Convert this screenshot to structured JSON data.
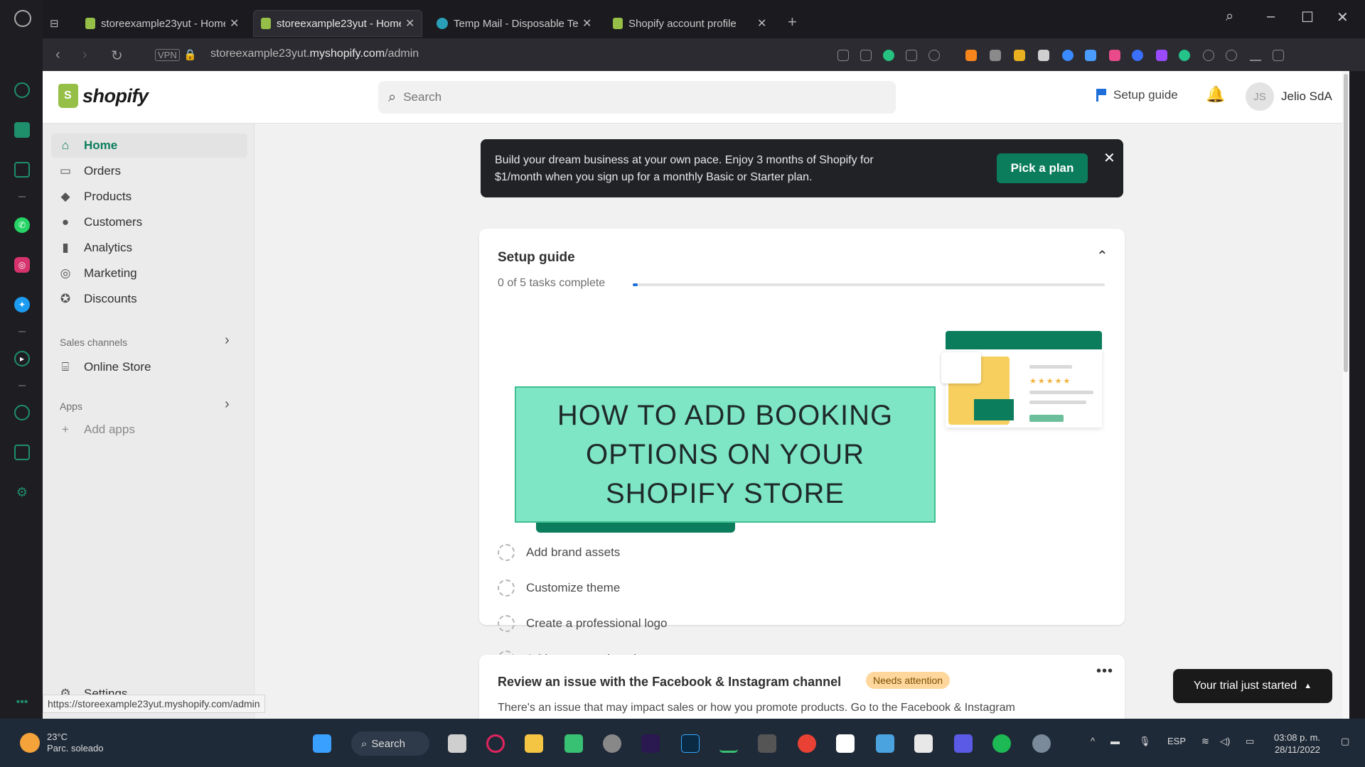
{
  "browser": {
    "tabs": [
      {
        "label": "storeexample23yut - Home",
        "active": false
      },
      {
        "label": "storeexample23yut - Home",
        "active": true
      },
      {
        "label": "Temp Mail - Disposable Te",
        "active": false
      },
      {
        "label": "Shopify account profile",
        "active": false
      }
    ],
    "url_prefix": "storeexample23yut.",
    "url_host": "myshopify.com",
    "url_path": "/admin",
    "status_url": "https://storeexample23yut.myshopify.com/admin"
  },
  "topbar": {
    "logo": "shopify",
    "search_placeholder": "Search",
    "setup_guide": "Setup guide",
    "user_initials": "JS",
    "user_name": "Jelio SdA"
  },
  "nav": {
    "items": [
      {
        "label": "Home",
        "icon": "home-icon"
      },
      {
        "label": "Orders",
        "icon": "orders-icon"
      },
      {
        "label": "Products",
        "icon": "tag-icon"
      },
      {
        "label": "Customers",
        "icon": "person-icon"
      },
      {
        "label": "Analytics",
        "icon": "bar-chart-icon"
      },
      {
        "label": "Marketing",
        "icon": "target-icon"
      },
      {
        "label": "Discounts",
        "icon": "discount-icon"
      }
    ],
    "sales_channels": "Sales channels",
    "online_store": "Online Store",
    "apps": "Apps",
    "add_apps": "Add apps",
    "settings": "Settings"
  },
  "banner": {
    "text": "Build your dream business at your own pace. Enjoy 3 months of Shopify for $1/month when you sign up for a monthly Basic or Starter plan.",
    "button": "Pick a plan"
  },
  "setup": {
    "title": "Setup guide",
    "progress_text": "0 of 5 tasks complete",
    "progress": 0.01,
    "tasks": [
      "Add brand assets",
      "Customize theme",
      "Create a professional logo",
      "Add a custom domain"
    ]
  },
  "overlay": {
    "title": "HOW TO ADD BOOKING OPTIONS ON YOUR SHOPIFY STORE"
  },
  "issue": {
    "title": "Review an issue with the Facebook & Instagram channel",
    "badge": "Needs attention",
    "text": "There's an issue that may impact sales or how you promote products. Go to the Facebook & Instagram"
  },
  "trial": "Your trial just started",
  "taskbar": {
    "temp": "23°C",
    "weather": "Parc. soleado",
    "search": "Search",
    "lang": "ESP",
    "time": "03:08 p. m.",
    "date": "28/11/2022"
  },
  "colors": {
    "brand": "#95bf47",
    "accent": "#0c7d5c",
    "overlay": "#7fe6c5"
  }
}
